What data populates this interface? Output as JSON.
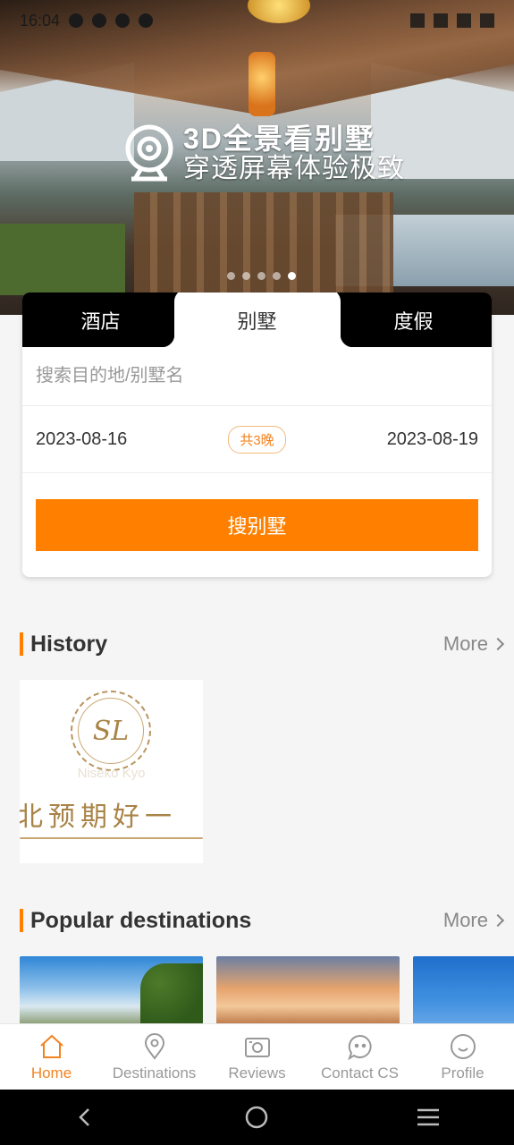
{
  "status_bar": {
    "time": "16:04"
  },
  "hero": {
    "promo_line1": "3D全景看别墅",
    "promo_line2": "穿透屏幕体验极致",
    "carousel_dots": 5,
    "active_dot": 5
  },
  "search_card": {
    "tabs": [
      {
        "label": "酒店",
        "active": false
      },
      {
        "label": "别墅",
        "active": true
      },
      {
        "label": "度假",
        "active": false
      }
    ],
    "search_placeholder": "搜索目的地/别墅名",
    "checkin": "2023-08-16",
    "nights": "共3晚",
    "checkout": "2023-08-19",
    "search_button": "搜别墅"
  },
  "history": {
    "title": "History",
    "more": "More",
    "item": {
      "logo_text": "SL",
      "brand": "Niseko Kyo",
      "calligraphy": "北预期好一"
    }
  },
  "popular": {
    "title": "Popular destinations",
    "more": "More"
  },
  "bottom_nav": [
    {
      "label": "Home",
      "icon": "home-icon",
      "active": true
    },
    {
      "label": "Destinations",
      "icon": "location-pin-icon",
      "active": false
    },
    {
      "label": "Reviews",
      "icon": "camera-icon",
      "active": false
    },
    {
      "label": "Contact CS",
      "icon": "chat-icon",
      "active": false
    },
    {
      "label": "Profile",
      "icon": "smile-icon",
      "active": false
    }
  ],
  "colors": {
    "accent": "#ff8000",
    "nav_active": "#f3831f",
    "nav_inactive": "#999999"
  }
}
